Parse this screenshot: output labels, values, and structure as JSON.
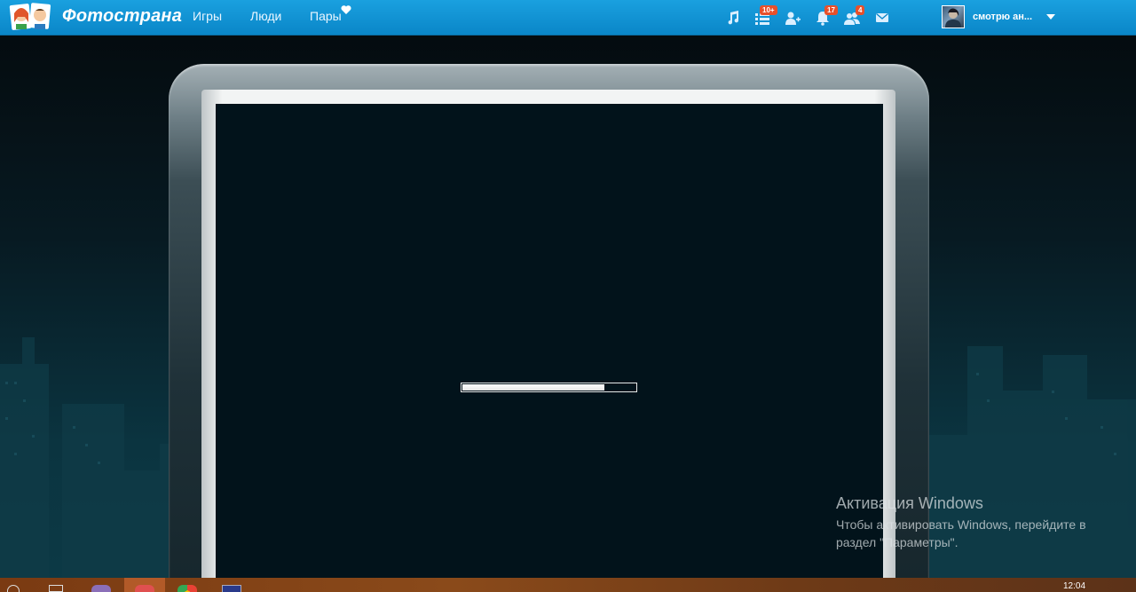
{
  "brand": {
    "name": "Фотострана"
  },
  "nav": [
    {
      "label": "Игры"
    },
    {
      "label": "Люди"
    },
    {
      "label": "Пары"
    }
  ],
  "header_icons": {
    "music": {
      "icon": "music-note-icon"
    },
    "feed": {
      "icon": "list-icon",
      "badge": "10+"
    },
    "friends": {
      "icon": "person-add-icon"
    },
    "notifications": {
      "icon": "bell-icon",
      "badge": "17"
    },
    "guests": {
      "icon": "people-icon",
      "badge": "4"
    },
    "messages": {
      "icon": "envelope-icon"
    }
  },
  "user": {
    "name": "смотрю ан..."
  },
  "loader": {
    "progress": 0.82
  },
  "watermark": {
    "title": "Активация Windows",
    "text": "Чтобы активировать Windows, перейдите в раздел \"Параметры\"."
  },
  "taskbar": {
    "clock": "12:04"
  },
  "colors": {
    "header": "#0c8fd0",
    "badge": "#e8502b",
    "screen": "#02131b",
    "taskbar": "#7a3a12"
  }
}
